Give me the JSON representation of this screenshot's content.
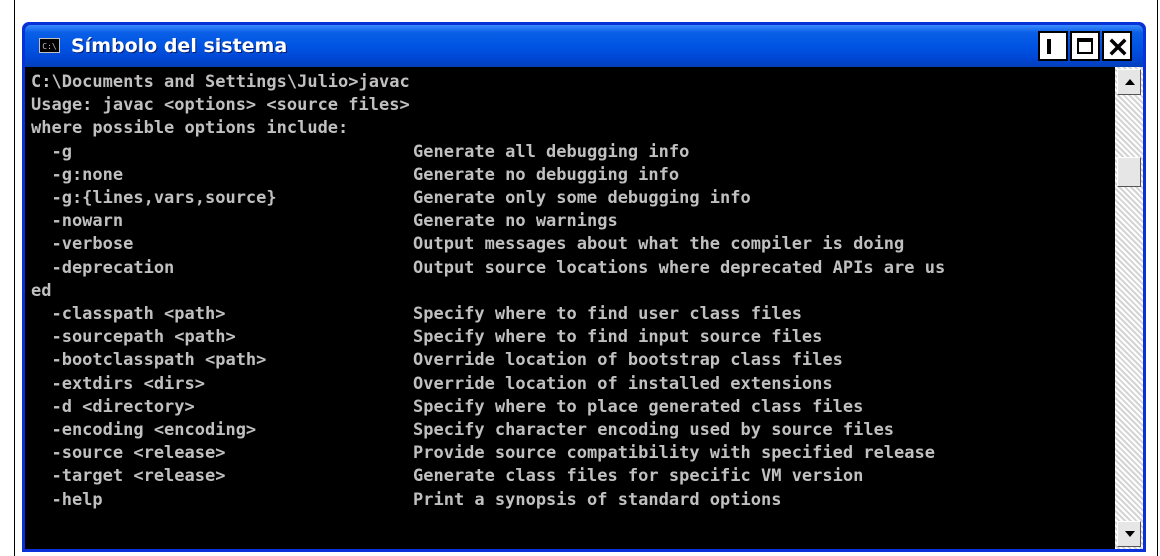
{
  "window": {
    "title": "Símbolo del sistema",
    "icon": "console-icon",
    "icon_text": "C:\\"
  },
  "controls": [
    "minimize-button",
    "maximize-button",
    "close-button"
  ],
  "console": {
    "lines": [
      {
        "text": "C:\\Documents and Settings\\Julio>javac"
      },
      {
        "text": "Usage: javac <options> <source files>"
      },
      {
        "text": "where possible options include:"
      },
      {
        "option": "  -g",
        "desc": "Generate all debugging info"
      },
      {
        "option": "  -g:none",
        "desc": "Generate no debugging info"
      },
      {
        "option": "  -g:{lines,vars,source}",
        "desc": "Generate only some debugging info"
      },
      {
        "option": "  -nowarn",
        "desc": "Generate no warnings"
      },
      {
        "option": "  -verbose",
        "desc": "Output messages about what the compiler is doing"
      },
      {
        "option": "  -deprecation",
        "desc": "Output source locations where deprecated APIs are us"
      },
      {
        "text": "ed"
      },
      {
        "option": "  -classpath <path>",
        "desc": "Specify where to find user class files"
      },
      {
        "option": "  -sourcepath <path>",
        "desc": "Specify where to find input source files"
      },
      {
        "option": "  -bootclasspath <path>",
        "desc": "Override location of bootstrap class files"
      },
      {
        "option": "  -extdirs <dirs>",
        "desc": "Override location of installed extensions"
      },
      {
        "option": "  -d <directory>",
        "desc": "Specify where to place generated class files"
      },
      {
        "option": "  -encoding <encoding>",
        "desc": "Specify character encoding used by source files"
      },
      {
        "option": "  -source <release>",
        "desc": "Provide source compatibility with specified release"
      },
      {
        "option": "  -target <release>",
        "desc": "Generate class files for specific VM version"
      },
      {
        "option": "  -help",
        "desc": "Print a synopsis of standard options"
      }
    ]
  },
  "colors": {
    "titlebar": "#0054e3",
    "console_bg": "#000000",
    "console_text": "#c0c0c0"
  }
}
